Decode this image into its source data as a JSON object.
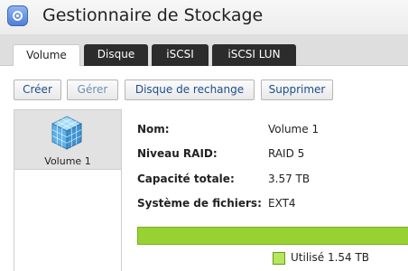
{
  "app": {
    "title": "Gestionnaire de Stockage",
    "icon": "storage-disk-icon"
  },
  "tabs": [
    {
      "label": "Volume",
      "active": true
    },
    {
      "label": "Disque",
      "active": false
    },
    {
      "label": "iSCSI",
      "active": false
    },
    {
      "label": "iSCSI LUN",
      "active": false
    }
  ],
  "toolbar": {
    "create_label": "Créer",
    "manage_label": "Gérer",
    "hot_spare_label": "Disque de rechange",
    "delete_label": "Supprimer"
  },
  "volumes": [
    {
      "name": "Volume 1",
      "icon": "volume-cube-icon",
      "selected": true
    }
  ],
  "details": {
    "name_label": "Nom:",
    "name_value": "Volume 1",
    "raid_label": "Niveau RAID:",
    "raid_value": "RAID 5",
    "capacity_label": "Capacité totale:",
    "capacity_value": "3.57 TB",
    "fs_label": "Système de fichiers:",
    "fs_value": "EXT4"
  },
  "usage": {
    "legend_label": "Utilisé 1.54 TB",
    "used_color": "#98d232"
  },
  "colors": {
    "tab_inactive_bg": "#2c2c2c",
    "button_text": "#1f4e8c",
    "selected_item_bg": "#e2e2e2"
  }
}
